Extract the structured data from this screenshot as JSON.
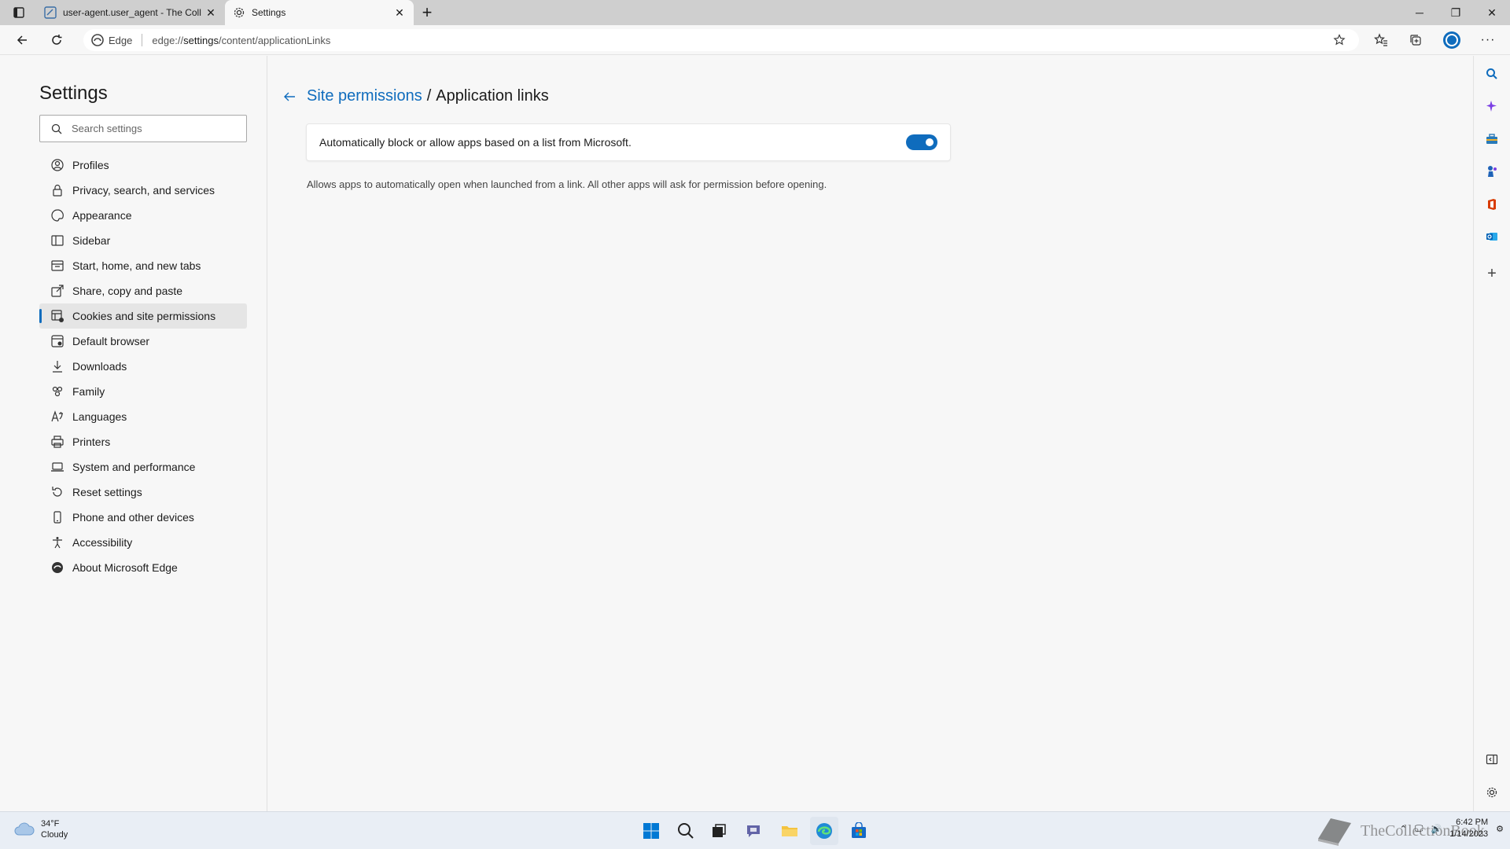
{
  "browser": {
    "tabs": [
      {
        "title": "user-agent.user_agent - The Coll",
        "active": false
      },
      {
        "title": "Settings",
        "active": true
      }
    ],
    "address": {
      "badge": "Edge",
      "url_prefix": "edge://",
      "url_main": "settings",
      "url_rest": "/content/applicationLinks"
    }
  },
  "settings": {
    "heading": "Settings",
    "search_placeholder": "Search settings",
    "nav_items": [
      {
        "label": "Profiles",
        "icon": "profile-icon"
      },
      {
        "label": "Privacy, search, and services",
        "icon": "lock-icon"
      },
      {
        "label": "Appearance",
        "icon": "palette-icon"
      },
      {
        "label": "Sidebar",
        "icon": "sidebar-icon"
      },
      {
        "label": "Start, home, and new tabs",
        "icon": "home-icon"
      },
      {
        "label": "Share, copy and paste",
        "icon": "share-icon"
      },
      {
        "label": "Cookies and site permissions",
        "icon": "cookies-icon",
        "selected": true
      },
      {
        "label": "Default browser",
        "icon": "browser-icon"
      },
      {
        "label": "Downloads",
        "icon": "download-icon"
      },
      {
        "label": "Family",
        "icon": "family-icon"
      },
      {
        "label": "Languages",
        "icon": "language-icon"
      },
      {
        "label": "Printers",
        "icon": "printer-icon"
      },
      {
        "label": "System and performance",
        "icon": "laptop-icon"
      },
      {
        "label": "Reset settings",
        "icon": "reset-icon"
      },
      {
        "label": "Phone and other devices",
        "icon": "phone-icon"
      },
      {
        "label": "Accessibility",
        "icon": "accessibility-icon"
      },
      {
        "label": "About Microsoft Edge",
        "icon": "edge-icon"
      }
    ]
  },
  "content": {
    "breadcrumb_link": "Site permissions",
    "breadcrumb_separator": "/",
    "breadcrumb_current": "Application links",
    "toggle_label": "Automatically block or allow apps based on a list from Microsoft.",
    "toggle_on": true,
    "description": "Allows apps to automatically open when launched from a link. All other apps will ask for permission before opening."
  },
  "taskbar": {
    "weather_temp": "34°F",
    "weather_cond": "Cloudy",
    "time": "6:42 PM",
    "date": "1/14/2023",
    "watermark": "TheCollectionBook"
  },
  "colors": {
    "accent": "#0f6cbd",
    "background": "#f7f7f7",
    "tabstrip": "#cfcfcf"
  }
}
